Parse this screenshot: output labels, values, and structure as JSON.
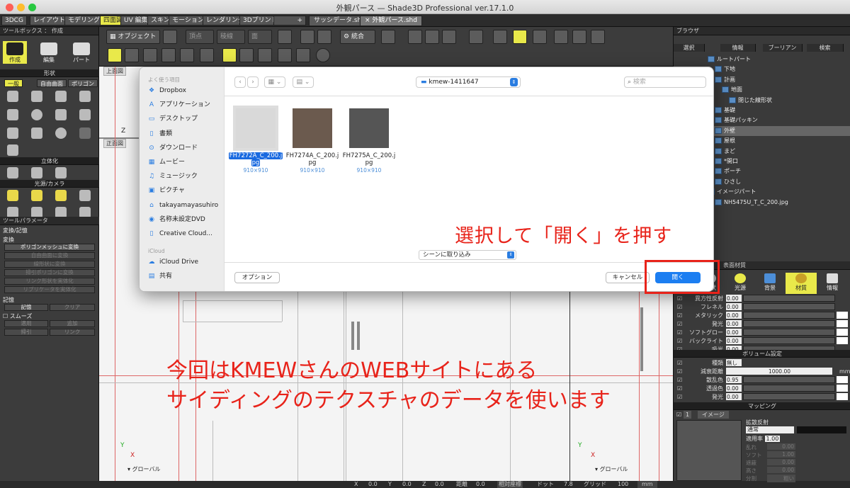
{
  "window": {
    "title": "外観パース — Shade3D Professional ver.17.1.0"
  },
  "mode_tabs": [
    "3DCG",
    "レイアウト",
    "モデリング",
    "四面図",
    "UV 編集",
    "スキン",
    "モーション",
    "レンダリング",
    "3Dプリント"
  ],
  "doc_tabs": [
    "サッシデータ.shd",
    "× 外観パース.shd"
  ],
  "toolbox": {
    "title": "ツールボックス ： 作成",
    "modes": [
      "作成",
      "編集",
      "パート"
    ],
    "shape_header": "形状",
    "shape_tabs": [
      "一般",
      "自由曲面",
      "ポリゴン"
    ],
    "solidify_header": "立体化",
    "light_header": "光源/カメラ"
  },
  "tool_params": {
    "title": "ツールパラメータ",
    "section": "変換/記憶",
    "convert_label": "変換",
    "convert_buttons": [
      "ポリゴンメッシュに変換",
      "自由曲面に変換",
      "線形状に変換",
      "掃引ポリゴンに変換",
      "リンク形状を実体化",
      "リプリケータを実体化"
    ],
    "memory_label": "記憶",
    "memory_buttons": [
      "記憶",
      "クリア"
    ],
    "smooth_label": "スムーズ",
    "smooth_buttons": [
      "適用",
      "追加",
      "掃引",
      "リンク"
    ]
  },
  "main_toolbar": {
    "object_label": "オブジェクト",
    "vertex_label": "頂点",
    "edge_label": "稜線",
    "face_label": "面",
    "merge_label": "統合",
    "view_top": "上面図",
    "view_front": "正面図"
  },
  "viewport": {
    "global_label_1": "グローバル",
    "global_label_2": "グローバル"
  },
  "statusbar": {
    "x_label": "X",
    "x_val": "0.0",
    "y_label": "Y",
    "y_val": "0.0",
    "z_label": "Z",
    "z_val": "0.0",
    "dist_label": "距離",
    "dist_val": "0.0",
    "coord_label": "相対座標",
    "dot_label": "ドット",
    "dot_val": "7.8",
    "grid_label": "グリッド",
    "grid_val": "100",
    "unit": "mm"
  },
  "browser": {
    "title": "ブラウザ",
    "columns": [
      "選択",
      "情報",
      "ブーリアン",
      "検索"
    ],
    "tree": [
      {
        "label": "ルートパート",
        "indent": 0
      },
      {
        "label": "下地",
        "indent": 1
      },
      {
        "label": "計画",
        "indent": 1
      },
      {
        "label": "地面",
        "indent": 2
      },
      {
        "label": "閉じた線形状",
        "indent": 3
      },
      {
        "label": "基礎",
        "indent": 1
      },
      {
        "label": "基礎パッキン",
        "indent": 1
      },
      {
        "label": "外壁",
        "indent": 1
      },
      {
        "label": "屋根",
        "indent": 1
      },
      {
        "label": "まど",
        "indent": 1
      },
      {
        "label": "*開口",
        "indent": 1
      },
      {
        "label": "ポーチ",
        "indent": 1
      },
      {
        "label": "ひさし",
        "indent": 1
      },
      {
        "label": "イメージパート",
        "indent": 0
      },
      {
        "label": "NH5475U_T_C_200.jpg",
        "indent": 1
      }
    ]
  },
  "surface": {
    "title": "表面材質",
    "tabs": [
      "形状",
      "光源",
      "背景",
      "材質",
      "情報"
    ],
    "rows": [
      {
        "label": "異方性反射",
        "value": "0.00"
      },
      {
        "label": "フレネル",
        "value": "0.00"
      },
      {
        "label": "メタリック",
        "value": "0.00"
      },
      {
        "label": "発光",
        "value": "0.00"
      },
      {
        "label": "ソフトグロー",
        "value": "0.00"
      },
      {
        "label": "バックライト",
        "value": "0.00"
      },
      {
        "label": "吸光",
        "value": "0.00"
      }
    ],
    "volume_header": "ボリューム設定",
    "type_label": "種類",
    "type_value": "無し",
    "attenuation_label": "減衰距離",
    "attenuation_value": "1000.00",
    "attenuation_unit": "mm",
    "scatter_label": "散乱色",
    "scatter_value": "0.95",
    "transmit_label": "透過色",
    "transmit_value": "0.00",
    "emit_label": "発光",
    "emit_value": "0.00",
    "mapping_header": "マッピング",
    "map_index": "1",
    "map_type": "イメージ",
    "map_channel": "拡散反射",
    "map_mode": "通常",
    "apply_label": "適用率",
    "apply_value": "1.00",
    "disabled_rows": [
      {
        "label": "乱れ",
        "value": "0.00"
      },
      {
        "label": "ソフト",
        "value": "1.00"
      },
      {
        "label": "遮蔽",
        "value": "0.00"
      },
      {
        "label": "高さ",
        "value": "0.00"
      },
      {
        "label": "分割",
        "value": "粗い"
      }
    ]
  },
  "dialog": {
    "sidebar_favorites": "よく使う項目",
    "favorites": [
      {
        "icon": "dropbox-icon",
        "glyph": "❖",
        "label": "Dropbox"
      },
      {
        "icon": "applications-icon",
        "glyph": "A",
        "label": "アプリケーション"
      },
      {
        "icon": "desktop-icon",
        "glyph": "▭",
        "label": "デスクトップ"
      },
      {
        "icon": "documents-icon",
        "glyph": "▯",
        "label": "書類"
      },
      {
        "icon": "downloads-icon",
        "glyph": "⊙",
        "label": "ダウンロード"
      },
      {
        "icon": "movies-icon",
        "glyph": "▦",
        "label": "ムービー"
      },
      {
        "icon": "music-icon",
        "glyph": "♫",
        "label": "ミュージック"
      },
      {
        "icon": "pictures-icon",
        "glyph": "▣",
        "label": "ピクチャ"
      },
      {
        "icon": "home-icon",
        "glyph": "⌂",
        "label": "takayamayasuhiro"
      },
      {
        "icon": "dvd-icon",
        "glyph": "◉",
        "label": "名称未設定DVD"
      },
      {
        "icon": "creative-cloud-icon",
        "glyph": "▯",
        "label": "Creative Cloud..."
      }
    ],
    "sidebar_icloud": "iCloud",
    "icloud_items": [
      {
        "icon": "icloud-drive-icon",
        "glyph": "☁",
        "label": "iCloud Drive"
      },
      {
        "icon": "shared-icon",
        "glyph": "▤",
        "label": "共有"
      }
    ],
    "folder": "kmew-1411647",
    "search_placeholder": "検索",
    "files": [
      {
        "name": "FH7272A_C_200.jpg",
        "name_line1": "FH7272A_C_200.j",
        "name_line2": "pg",
        "dims": "910×910",
        "selected": true,
        "color": "#d9d9d9"
      },
      {
        "name": "FH7274A_C_200.jpg",
        "name_line1": "FH7274A_C_200.j",
        "name_line2": "pg",
        "dims": "910×910",
        "selected": false,
        "color": "#6b5a4e"
      },
      {
        "name": "FH7275A_C_200.jpg",
        "name_line1": "FH7275A_C_200.j",
        "name_line2": "pg",
        "dims": "910×910",
        "selected": false,
        "color": "#555555"
      }
    ],
    "import_option": "シーンに取り込み",
    "options_button": "オプション",
    "cancel_button": "キャンセル",
    "open_button": "開く"
  },
  "annotations": {
    "instruction": "選択して「開く」を押す",
    "note_line1": "今回はKMEWさんのWEBサイトにある",
    "note_line2": "サイディングのテクスチャのデータを使います",
    "color": "#e8231a"
  }
}
